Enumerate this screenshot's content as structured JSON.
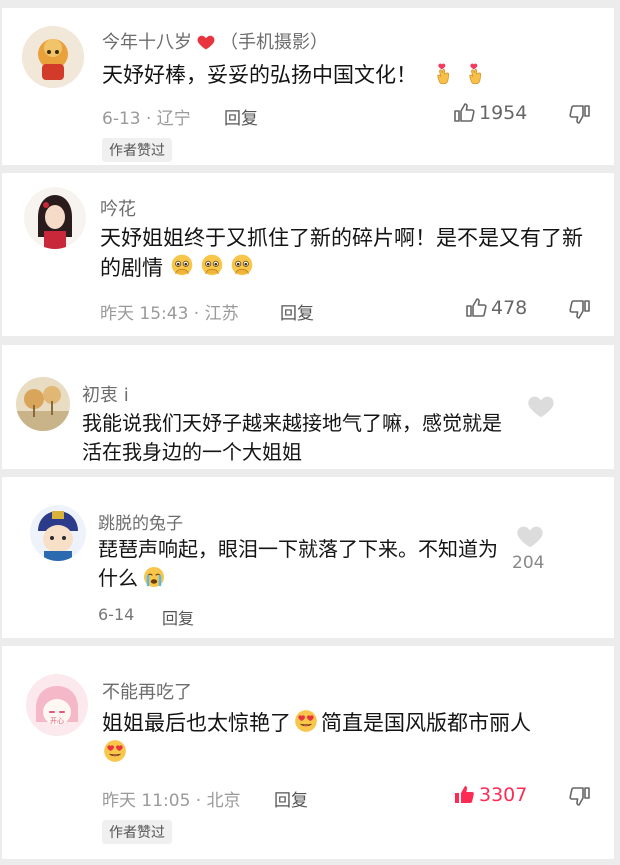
{
  "comments": [
    {
      "username": "今年十八岁",
      "tag": "（手机摄影）",
      "text": "天妤好棒，妥妥的弘扬中国文化！",
      "time_location": "6-13 · 辽宁",
      "reply_label": "回复",
      "like_count": "1954",
      "author_liked": "作者赞过"
    },
    {
      "username": "吟花",
      "text": "天妤姐姐终于又抓住了新的碎片啊！是不是又有了新的剧情",
      "time_location": "昨天 15:43 · 江苏",
      "reply_label": "回复",
      "like_count": "478"
    },
    {
      "username": "初衷 i",
      "text": "我能说我们天妤子越来越接地气了嘛，感觉就是活在我身边的一个大姐姐"
    },
    {
      "username": "跳脱的兔子",
      "text": "琵琶声响起，眼泪一下就落了下来。不知道为什么",
      "time_location": "6-14",
      "reply_label": "回复",
      "like_count": "204"
    },
    {
      "username": "不能再吃了",
      "text": "姐姐最后也太惊艳了",
      "text_2": "简直是国风版都市丽人",
      "time_location": "昨天 11:05 · 北京",
      "reply_label": "回复",
      "like_count": "3307",
      "author_liked": "作者赞过",
      "avatar_text": "开心"
    }
  ],
  "colors": {
    "liked_red": "#fe2c55",
    "muted": "#9a9a9a",
    "heart": "#e8343f"
  }
}
